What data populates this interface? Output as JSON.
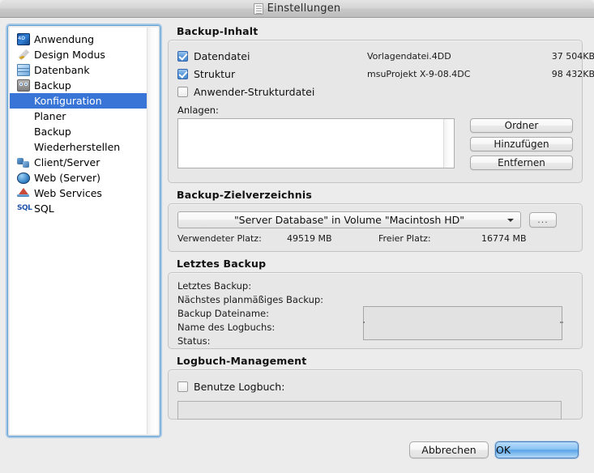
{
  "window": {
    "title": "Einstellungen",
    "title_icon": "document-icon"
  },
  "sidebar": {
    "items": [
      {
        "label": "Anwendung",
        "icon": "app-cube-icon",
        "level": 0,
        "selected": false
      },
      {
        "label": "Design Modus",
        "icon": "design-tool-icon",
        "level": 0,
        "selected": false
      },
      {
        "label": "Datenbank",
        "icon": "database-cube-icon",
        "level": 0,
        "selected": false
      },
      {
        "label": "Backup",
        "icon": "backup-drive-icon",
        "level": 0,
        "selected": false
      },
      {
        "label": "Konfiguration",
        "icon": "",
        "level": 1,
        "selected": true
      },
      {
        "label": "Planer",
        "icon": "",
        "level": 1,
        "selected": false
      },
      {
        "label": "Backup",
        "icon": "",
        "level": 1,
        "selected": false
      },
      {
        "label": "Wiederherstellen",
        "icon": "",
        "level": 1,
        "selected": false
      },
      {
        "label": "Client/Server",
        "icon": "client-server-icon",
        "level": 0,
        "selected": false
      },
      {
        "label": "Web (Server)",
        "icon": "globe-icon",
        "level": 0,
        "selected": false
      },
      {
        "label": "Web Services",
        "icon": "web-services-icon",
        "level": 0,
        "selected": false
      },
      {
        "label": "SQL",
        "icon": "sql-icon",
        "level": 0,
        "selected": false
      }
    ]
  },
  "backup_content": {
    "title": "Backup-Inhalt",
    "rows": [
      {
        "label": "Datendatei",
        "checked": true,
        "file": "Vorlagendatei.4DD",
        "size": "37 504KB"
      },
      {
        "label": "Struktur",
        "checked": true,
        "file": "msuProjekt X-9-08.4DC",
        "size": "98 432KB"
      },
      {
        "label": "Anwender-Strukturdatei",
        "checked": false,
        "file": "",
        "size": ""
      }
    ],
    "attachments_label": "Anlagen:",
    "attachments_items": [],
    "buttons": {
      "folder": "Ordner",
      "add": "Hinzufügen",
      "remove": "Entfernen"
    }
  },
  "destination": {
    "title": "Backup-Zielverzeichnis",
    "selected_path": "\"Server Database\" in Volume \"Macintosh HD\"",
    "browse_button": "...",
    "used_label": "Verwendeter Platz:",
    "used_value": "49519 MB",
    "free_label": "Freier Platz:",
    "free_value": "16774 MB"
  },
  "last_backup": {
    "title": "Letztes Backup",
    "fields": [
      {
        "label": "Letztes Backup:",
        "value": ""
      },
      {
        "label": "Nächstes planmäßiges Backup:",
        "value": ""
      },
      {
        "label": "Backup Dateiname:",
        "value": ""
      },
      {
        "label": "Name des Logbuchs:",
        "value": ""
      },
      {
        "label": "Status:",
        "value": ""
      }
    ],
    "detail_text": ""
  },
  "log_management": {
    "title": "Logbuch-Management",
    "use_log_label": "Benutze Logbuch:",
    "use_log_checked": false,
    "log_path_value": ""
  },
  "footer": {
    "cancel": "Abbrechen",
    "ok": "OK"
  },
  "colors": {
    "selection_blue": "#3875d7",
    "checkbox_blue": "#5d9ada",
    "default_button_blue": "#8cc4f4",
    "window_bg": "#ececec",
    "group_bg": "#e7e7e7"
  }
}
